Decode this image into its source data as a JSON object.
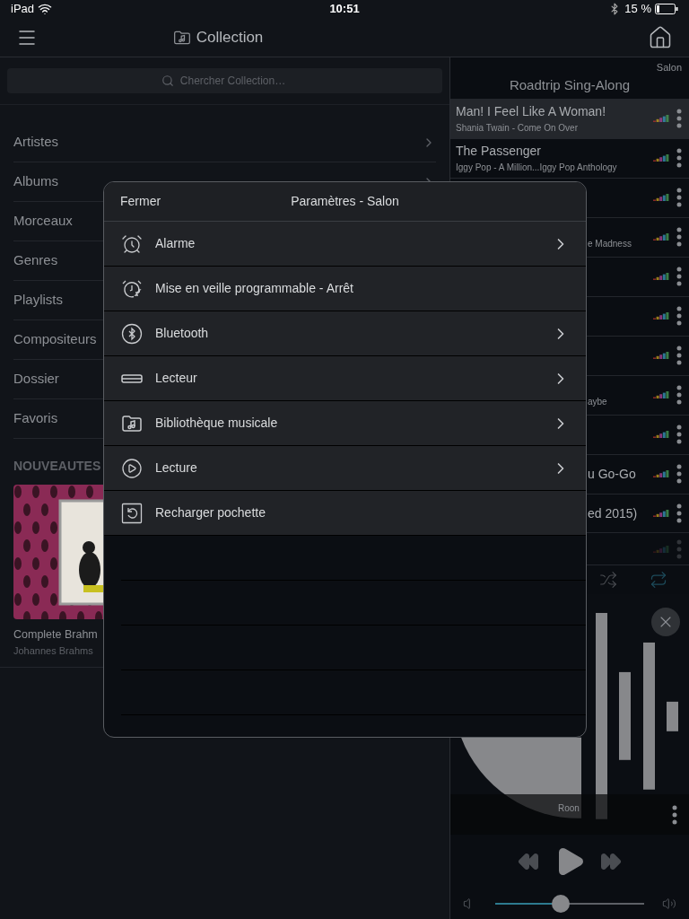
{
  "status_bar": {
    "device": "iPad",
    "time": "10:51",
    "battery": "15 %"
  },
  "header": {
    "title": "Collection"
  },
  "search": {
    "placeholder": "Chercher Collection…"
  },
  "browse": [
    {
      "label": "Artistes",
      "chevron": true
    },
    {
      "label": "Albums",
      "chevron": true
    },
    {
      "label": "Morceaux"
    },
    {
      "label": "Genres"
    },
    {
      "label": "Playlists"
    },
    {
      "label": "Compositeurs"
    },
    {
      "label": "Dossier"
    },
    {
      "label": "Favoris"
    }
  ],
  "new_section": {
    "title": "NOUVEAUTES",
    "album": {
      "title": "Complete Brahm",
      "artist": "Johannes Brahms"
    }
  },
  "queue": {
    "zone": "Salon",
    "title": "Roadtrip Sing-Along",
    "rows": [
      {
        "kind": "full",
        "title": "Man! I Feel Like A Woman!",
        "subtitle": "Shania Twain - Come On Over",
        "selected": true
      },
      {
        "kind": "full",
        "title": "The Passenger",
        "subtitle": "Iggy Pop - A Million...Iggy Pop Anthology",
        "selected": false
      },
      {
        "kind": "partial",
        "selected": false
      },
      {
        "kind": "partial",
        "subtitle": "e Madness",
        "selected": false
      },
      {
        "kind": "partial",
        "selected": false
      },
      {
        "kind": "partial",
        "selected": false
      },
      {
        "kind": "partial",
        "selected": false
      },
      {
        "kind": "partial",
        "subtitle": "aybe",
        "selected": false
      },
      {
        "kind": "partial",
        "selected": false
      },
      {
        "kind": "partial",
        "title": "u Go-Go",
        "selected": false
      },
      {
        "kind": "partial",
        "title": "ed 2015)",
        "selected": false
      },
      {
        "kind": "faded",
        "selected": false
      }
    ]
  },
  "now_playing": {
    "zone_name": "Roon",
    "volume": {
      "level": 0.44
    }
  },
  "dialog": {
    "close": "Fermer",
    "title": "Paramètres - Salon",
    "items": [
      {
        "kind": "alarm",
        "label": "Alarme",
        "chevron": true
      },
      {
        "kind": "sleep",
        "label": "Mise en veille programmable - Arrêt",
        "chevron": false
      },
      {
        "kind": "bluetooth",
        "label": "Bluetooth",
        "chevron": true
      },
      {
        "kind": "player",
        "label": "Lecteur",
        "chevron": true
      },
      {
        "kind": "library",
        "label": "Bibliothèque musicale",
        "chevron": true
      },
      {
        "kind": "play",
        "label": "Lecture",
        "chevron": true
      },
      {
        "kind": "reload",
        "label": "Recharger pochette",
        "chevron": false
      }
    ]
  }
}
